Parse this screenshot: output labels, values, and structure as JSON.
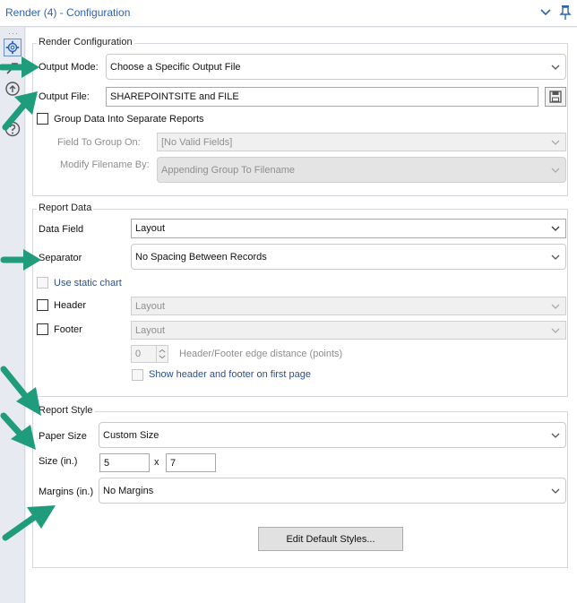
{
  "window": {
    "title": "Render (4) - Configuration"
  },
  "render_config": {
    "legend": "Render Configuration",
    "output_mode_label": "Output Mode:",
    "output_mode_value": "Choose a Specific Output File",
    "output_file_label": "Output File:",
    "output_file_value": "SHAREPOINTSITE and FILE",
    "group_data_label": "Group Data Into Separate Reports",
    "group_data_checked": false,
    "field_to_group_label": "Field To Group On:",
    "field_to_group_value": "[No Valid Fields]",
    "modify_filename_label": "Modify Filename By:",
    "modify_filename_value": "Appending Group To Filename"
  },
  "report_data": {
    "legend": "Report Data",
    "data_field_label": "Data Field",
    "data_field_value": "Layout",
    "separator_label": "Separator",
    "separator_value": "No Spacing Between Records",
    "static_chart_label": "Use static chart",
    "static_chart_checked": false,
    "header_label": "Header",
    "header_checked": false,
    "header_value": "Layout",
    "footer_label": "Footer",
    "footer_checked": false,
    "footer_value": "Layout",
    "edge_distance_value": "0",
    "edge_distance_label": "Header/Footer edge distance (points)",
    "show_first_page_label": "Show header and footer on first page",
    "show_first_page_checked": false
  },
  "report_style": {
    "legend": "Report Style",
    "paper_size_label": "Paper Size",
    "paper_size_value": "Custom Size",
    "size_label": "Size (in.)",
    "size_width": "5",
    "size_x": "x",
    "size_height": "7",
    "margins_label": "Margins (in.)",
    "margins_value": "No Margins",
    "edit_styles_label": "Edit Default Styles..."
  },
  "icons": {
    "rail": [
      "gear-icon",
      "tool-icon",
      "workflow-icon",
      "help-icon"
    ],
    "titlebar": [
      "chevron-down-icon",
      "pin-icon"
    ],
    "annotation_color": "#1e9c7c",
    "accent_color": "#2d62b8"
  }
}
